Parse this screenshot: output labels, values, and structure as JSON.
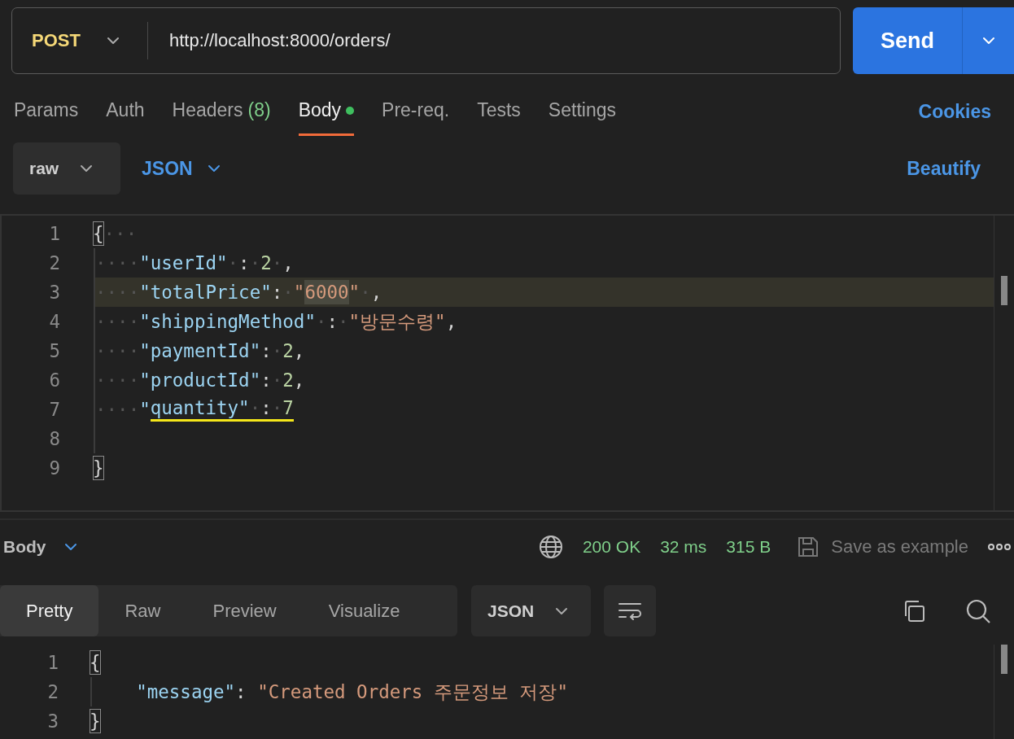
{
  "request": {
    "method": "POST",
    "url": "http://localhost:8000/orders/",
    "send": "Send"
  },
  "tabs": [
    {
      "label": "Params",
      "selected": false,
      "dot": false
    },
    {
      "label": "Auth",
      "selected": false,
      "dot": false
    },
    {
      "label": "Headers",
      "count": "(8)",
      "selected": false,
      "dot": false
    },
    {
      "label": "Body",
      "selected": true,
      "dot": true
    },
    {
      "label": "Pre-req.",
      "selected": false,
      "dot": false
    },
    {
      "label": "Tests",
      "selected": false,
      "dot": false
    },
    {
      "label": "Settings",
      "selected": false,
      "dot": false
    }
  ],
  "cookies": "Cookies",
  "body_mode": "raw",
  "body_language": "JSON",
  "beautify": "Beautify",
  "editor": {
    "lines": [
      {
        "number": "1",
        "current": false,
        "tokens": [
          {
            "kind": "punct",
            "text": "{",
            "boxed": true
          },
          {
            "kind": "ws",
            "text": "···"
          }
        ]
      },
      {
        "number": "2",
        "current": false,
        "tokens": [
          {
            "kind": "ws",
            "text": "····"
          },
          {
            "kind": "key",
            "text": "\"userId\""
          },
          {
            "kind": "ws",
            "text": "·"
          },
          {
            "kind": "punct",
            "text": ":"
          },
          {
            "kind": "ws",
            "text": "·"
          },
          {
            "kind": "number",
            "text": "2"
          },
          {
            "kind": "ws",
            "text": "·"
          },
          {
            "kind": "punct",
            "text": ","
          }
        ]
      },
      {
        "number": "3",
        "current": true,
        "tokens": [
          {
            "kind": "ws",
            "text": "····"
          },
          {
            "kind": "key",
            "text": "\"totalPrice\""
          },
          {
            "kind": "punct",
            "text": ":"
          },
          {
            "kind": "ws",
            "text": "·"
          },
          {
            "kind": "string",
            "text": "\""
          },
          {
            "kind": "string",
            "text": "6000",
            "highlighted": true
          },
          {
            "kind": "string",
            "text": "\""
          },
          {
            "kind": "ws",
            "text": "·"
          },
          {
            "kind": "punct",
            "text": ","
          }
        ]
      },
      {
        "number": "4",
        "current": false,
        "tokens": [
          {
            "kind": "ws",
            "text": "····"
          },
          {
            "kind": "key",
            "text": "\"shippingMethod\""
          },
          {
            "kind": "ws",
            "text": "·"
          },
          {
            "kind": "punct",
            "text": ":"
          },
          {
            "kind": "ws",
            "text": "·"
          },
          {
            "kind": "string",
            "text": "\"방문수령\""
          },
          {
            "kind": "punct",
            "text": ","
          }
        ]
      },
      {
        "number": "5",
        "current": false,
        "tokens": [
          {
            "kind": "ws",
            "text": "····"
          },
          {
            "kind": "key",
            "text": "\"paymentId\""
          },
          {
            "kind": "punct",
            "text": ":"
          },
          {
            "kind": "ws",
            "text": "·"
          },
          {
            "kind": "number",
            "text": "2"
          },
          {
            "kind": "punct",
            "text": ","
          }
        ]
      },
      {
        "number": "6",
        "current": false,
        "tokens": [
          {
            "kind": "ws",
            "text": "····"
          },
          {
            "kind": "key",
            "text": "\"productId\""
          },
          {
            "kind": "punct",
            "text": ":"
          },
          {
            "kind": "ws",
            "text": "·"
          },
          {
            "kind": "number",
            "text": "2"
          },
          {
            "kind": "punct",
            "text": ","
          }
        ]
      },
      {
        "number": "7",
        "current": false,
        "tokens": [
          {
            "kind": "ws",
            "text": "····"
          },
          {
            "kind": "key",
            "text": "\""
          },
          {
            "kind": "key",
            "text": "quantity\"",
            "underlined": true
          },
          {
            "kind": "ws",
            "text": "·",
            "underlined": true
          },
          {
            "kind": "punct",
            "text": ":",
            "underlined": true
          },
          {
            "kind": "ws",
            "text": "·",
            "underlined": true
          },
          {
            "kind": "number",
            "text": "7",
            "underlined": true
          }
        ]
      },
      {
        "number": "8",
        "current": false
      },
      {
        "number": "9",
        "current": false,
        "tokens": [
          {
            "kind": "punct",
            "text": "}",
            "boxed": true
          }
        ]
      }
    ]
  },
  "response": {
    "title": "Body",
    "status": "200 OK",
    "time": "32 ms",
    "size": "315 B",
    "save": "Save as example",
    "view_tabs": [
      {
        "label": "Pretty",
        "selected": true
      },
      {
        "label": "Raw",
        "selected": false
      },
      {
        "label": "Preview",
        "selected": false
      },
      {
        "label": "Visualize",
        "selected": false
      }
    ],
    "format": "JSON",
    "lines": [
      {
        "number": "1",
        "current": false,
        "tokens": [
          {
            "kind": "punct",
            "text": "{",
            "boxed": true
          }
        ]
      },
      {
        "number": "2",
        "current": false,
        "tokens": [
          {
            "kind": "key",
            "text": "    \"message\""
          },
          {
            "kind": "punct",
            "text": ": "
          },
          {
            "kind": "string",
            "text": "\"Created Orders 주문정보 저장\""
          }
        ]
      },
      {
        "number": "3",
        "current": false,
        "tokens": [
          {
            "kind": "punct",
            "text": "}",
            "boxed": true
          }
        ]
      }
    ]
  }
}
